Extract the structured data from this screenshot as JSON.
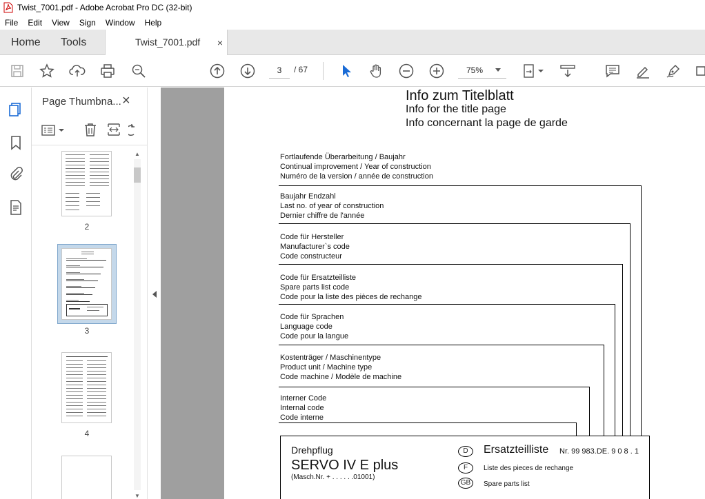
{
  "window": {
    "title": "Twist_7001.pdf - Adobe Acrobat Pro DC (32-bit)"
  },
  "menu": [
    "File",
    "Edit",
    "View",
    "Sign",
    "Window",
    "Help"
  ],
  "tabs": {
    "home": "Home",
    "tools": "Tools",
    "document": "Twist_7001.pdf",
    "close": "×"
  },
  "toolbar": {
    "current_page": "3",
    "page_total": "/ 67",
    "zoom": "75%"
  },
  "thumbnails": {
    "title": "Page Thumbna...",
    "close": "×",
    "pages": [
      "2",
      "3",
      "4"
    ],
    "selected": "3"
  },
  "pdf": {
    "heading": "Info  zum  Titelblatt",
    "subheading_en": "Info for the title page",
    "subheading_fr": "Info concernant la page de garde",
    "groups": [
      [
        "Fortlaufende Überarbeitung / Baujahr",
        "Continual improvement / Year of construction",
        "Numéro de la version / année de construction"
      ],
      [
        "Baujahr Endzahl",
        "Last no. of year of construction",
        "Dernier chiffre de l'année"
      ],
      [
        "Code für Hersteller",
        "Manufacturer`s  code",
        "Code constructeur"
      ],
      [
        "Code für Ersatzteilliste",
        "Spare parts list code",
        "Code pour la liste des pièces de rechange"
      ],
      [
        "Code für Sprachen",
        "Language code",
        "Code pour la langue"
      ],
      [
        "Kostenträger / Maschinentype",
        "Product unit / Machine type",
        "Code machine / Modèle de machine"
      ],
      [
        "Interner Code",
        "Internal code",
        "Code interne"
      ]
    ],
    "box": {
      "product_kind": "Drehpflug",
      "product_name": "SERVO IV E plus",
      "serial": "(Masch.Nr. + . . . . . .01001)",
      "lang_d": "D",
      "lang_f": "F",
      "lang_gb": "GB",
      "de_label": "Ersatzteilliste",
      "number": "Nr. 99 983.DE. 9 0 8 . 1",
      "fr_label": "Liste des pieces de rechange",
      "en_label": "Spare parts list"
    }
  }
}
